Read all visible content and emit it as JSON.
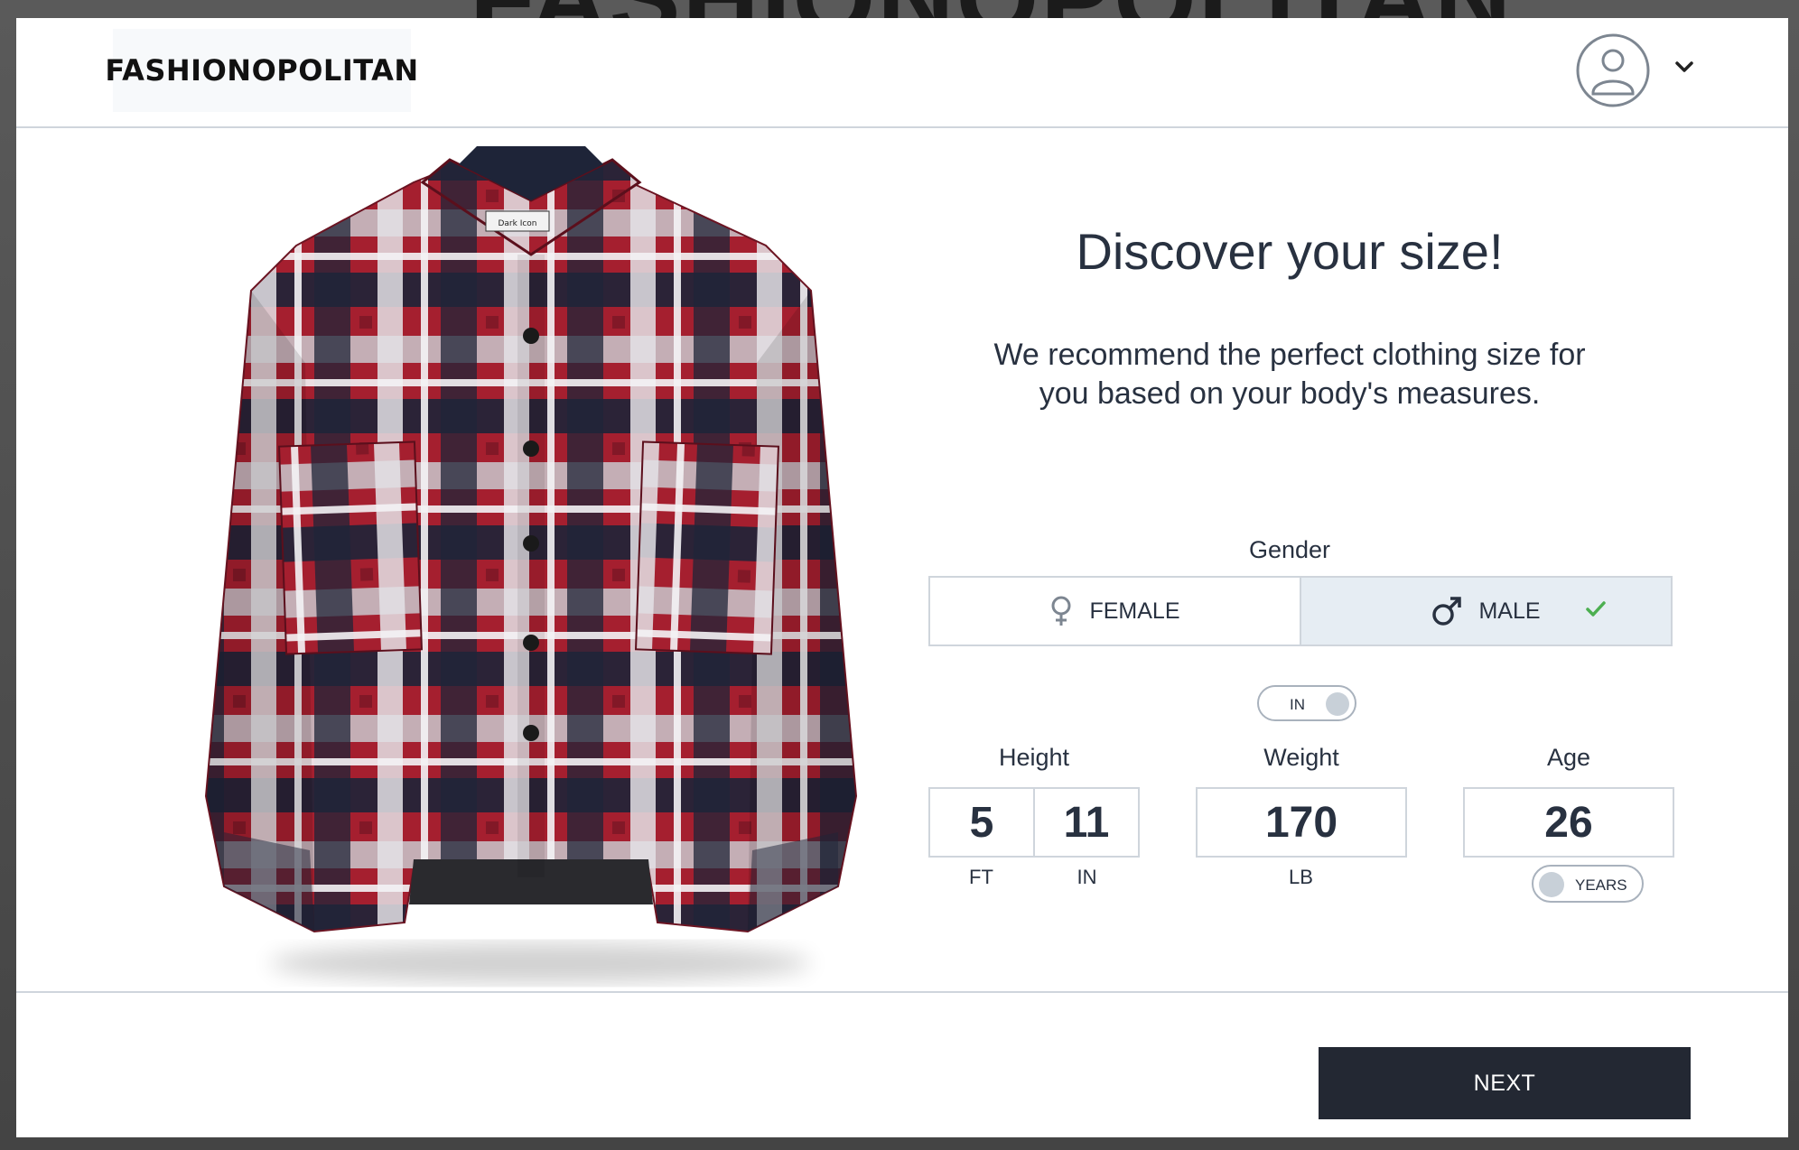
{
  "brand": {
    "logo_text": "FASHIONOPOLITAN",
    "background_text": "FASHIONOPOLITAN"
  },
  "header": {
    "avatar_icon": "user-avatar-icon",
    "menu_icon": "chevron-down-icon"
  },
  "product": {
    "image_icon": "plaid-shirt-image",
    "tag_text": "Dark Icon"
  },
  "dialog": {
    "title": "Discover your size!",
    "subtitle": "We recommend the perfect clothing size for you based on your body's measures."
  },
  "gender": {
    "label": "Gender",
    "options": [
      {
        "label": "FEMALE",
        "icon": "female-symbol-icon",
        "selected": false
      },
      {
        "label": "MALE",
        "icon": "male-symbol-icon",
        "selected": true
      }
    ],
    "selected_icon": "checkmark-icon"
  },
  "unit_toggle": {
    "label": "IN"
  },
  "height": {
    "label": "Height",
    "feet": "5",
    "inches": "11",
    "feet_unit": "FT",
    "inches_unit": "IN"
  },
  "weight": {
    "label": "Weight",
    "value": "170",
    "unit": "LB"
  },
  "age": {
    "label": "Age",
    "value": "26",
    "unit_toggle_label": "YEARS"
  },
  "footer": {
    "next_label": "NEXT"
  },
  "colors": {
    "accent": "#232833",
    "text": "#283140",
    "border": "#cfd5dc",
    "selected_bg": "#e6edf3",
    "check": "#4caf50"
  }
}
